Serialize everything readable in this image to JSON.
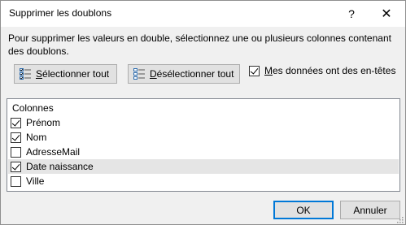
{
  "window": {
    "title": "Supprimer les doublons",
    "help_label": "?",
    "close_label": "✕"
  },
  "instructions": "Pour supprimer les valeurs en double, sélectionnez une ou plusieurs colonnes contenant des doublons.",
  "toolbar": {
    "select_all": {
      "accel": "S",
      "rest": "électionner tout"
    },
    "deselect_all": {
      "accel": "D",
      "rest": "ésélectionner tout"
    }
  },
  "headers_option": {
    "label_accel": "M",
    "label_rest": "es données ont des en-têtes",
    "checked": true
  },
  "columns": {
    "header": "Colonnes",
    "items": [
      {
        "label": "Prénom",
        "checked": true
      },
      {
        "label": "Nom",
        "checked": true
      },
      {
        "label": "AdresseMail",
        "checked": false
      },
      {
        "label": "Date naissance",
        "checked": true,
        "highlighted": true
      },
      {
        "label": "Ville",
        "checked": false
      }
    ]
  },
  "buttons": {
    "ok": "OK",
    "cancel": "Annuler"
  },
  "colors": {
    "accent": "#0078d7",
    "dialog_bg": "#f0f0f0",
    "row_highlight": "#e5e5e5"
  }
}
